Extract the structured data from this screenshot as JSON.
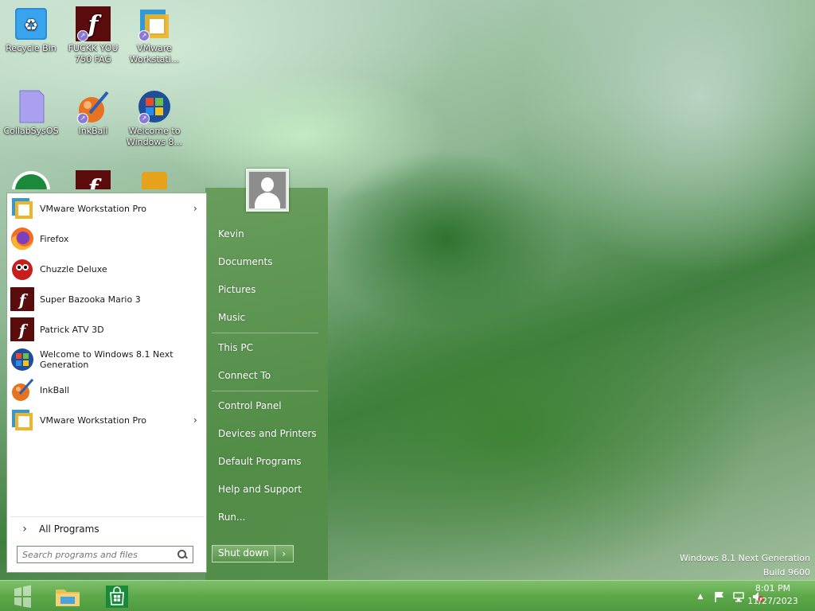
{
  "desktop": {
    "icons": [
      {
        "label": "Recycle Bin",
        "icon": "recycle-bin-icon"
      },
      {
        "label": "FUCKK YOU 750 FAG",
        "icon": "flash-icon"
      },
      {
        "label": "VMware Workstati...",
        "icon": "vmware-icon"
      },
      {
        "label": "CollabSysOS",
        "icon": "file-icon"
      },
      {
        "label": "InkBall",
        "icon": "inkball-icon"
      },
      {
        "label": "Welcome to Windows 8...",
        "icon": "windows-logo-icon"
      }
    ]
  },
  "start_menu": {
    "programs": [
      {
        "label": "VMware Workstation Pro",
        "icon": "vmware-icon",
        "submenu": true
      },
      {
        "label": "Firefox",
        "icon": "firefox-icon",
        "submenu": false
      },
      {
        "label": "Chuzzle Deluxe",
        "icon": "chuzzle-icon",
        "submenu": false
      },
      {
        "label": "Super Bazooka Mario 3",
        "icon": "flash-icon",
        "submenu": false
      },
      {
        "label": "Patrick ATV 3D",
        "icon": "flash-icon",
        "submenu": false
      },
      {
        "label": "Welcome to Windows 8.1 Next Generation",
        "icon": "windows-logo-icon",
        "submenu": false
      },
      {
        "label": "InkBall",
        "icon": "inkball-icon",
        "submenu": false
      },
      {
        "label": "VMware Workstation Pro",
        "icon": "vmware-icon",
        "submenu": true
      }
    ],
    "all_programs": "All Programs",
    "search_placeholder": "Search programs and files",
    "places": {
      "user": "Kevin",
      "documents": "Documents",
      "pictures": "Pictures",
      "music": "Music",
      "this_pc": "This PC",
      "connect_to": "Connect To",
      "control_panel": "Control Panel",
      "devices_printers": "Devices and Printers",
      "default_programs": "Default Programs",
      "help_support": "Help and Support",
      "run": "Run..."
    },
    "shutdown_label": "Shut down"
  },
  "watermark": {
    "line1": "Windows 8.1 Next Generation",
    "line2": "Build 9600"
  },
  "taskbar": {
    "pinned": [
      {
        "name": "file-explorer",
        "icon": "folder-icon"
      },
      {
        "name": "store",
        "icon": "store-icon"
      }
    ],
    "clock": {
      "time": "8:01 PM",
      "date": "11/27/2023"
    }
  },
  "colors": {
    "accent": "#5ea84b",
    "start_right_panel": "#5f9650",
    "flash_red": "#5a0b0b"
  }
}
